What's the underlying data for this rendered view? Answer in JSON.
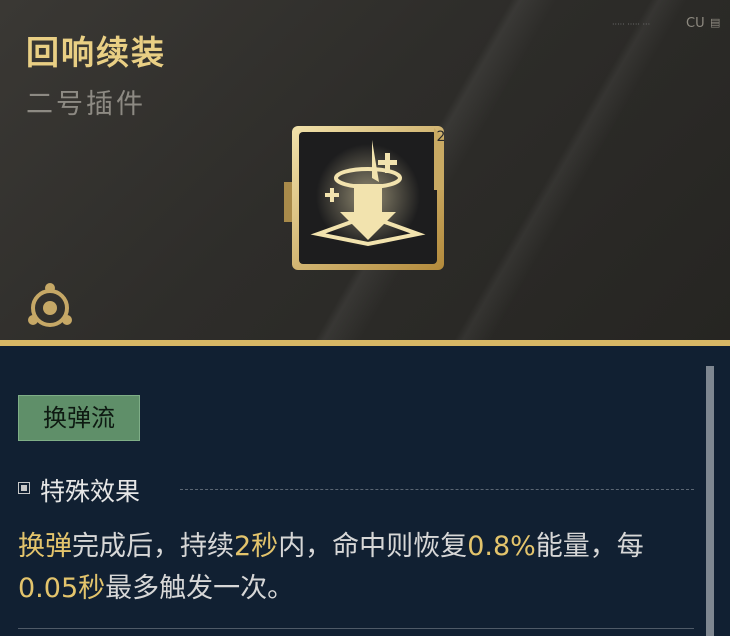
{
  "header": {
    "title": "回响续装",
    "subtitle": "二号插件",
    "tiny_caption": "·····  ·····  ···",
    "code": "CU",
    "mini": "≡\n⊞"
  },
  "item": {
    "icon_name": "reload-echo-icon",
    "level": "2"
  },
  "tag": {
    "label": "换弹流"
  },
  "section": {
    "title": "特殊效果"
  },
  "description": {
    "p1": "换弹",
    "p2": "完成后，持续",
    "p3": "2秒",
    "p4": "内，命中则恢复",
    "p5": "0.8%",
    "p6": "能量，每",
    "p7": "0.05秒",
    "p8": "最多触发一次。"
  },
  "colors": {
    "gold": "#e9cf84",
    "highlight": "#e3c46c",
    "tag_green": "#5f8f69",
    "panel": "#112032"
  }
}
